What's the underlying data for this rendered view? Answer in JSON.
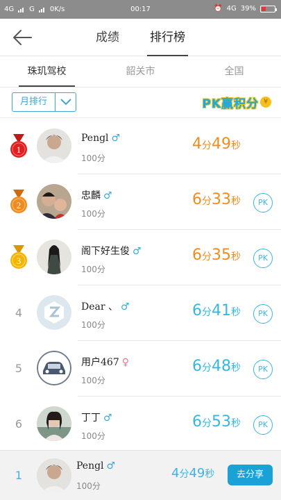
{
  "status_bar": {
    "network_left": "4G",
    "network_left2": "G",
    "speed": "0K/s",
    "time": "00:17",
    "network_right": "4G",
    "battery": "39%"
  },
  "header": {
    "tabs": [
      {
        "label": "成绩"
      },
      {
        "label": "排行榜"
      }
    ]
  },
  "subtabs": [
    {
      "label": "珠玑驾校"
    },
    {
      "label": "韶关市"
    },
    {
      "label": "全国"
    }
  ],
  "filter": {
    "period_label": "月排行",
    "banner_text": "PK赢积分",
    "banner_coin": "¥"
  },
  "rankings": [
    {
      "rank": "1",
      "name": "Pengl",
      "sex": "♂",
      "score": "100分",
      "min": "4",
      "sec": "49",
      "min_unit": "分",
      "sec_unit": "秒",
      "color": "#f08c1e",
      "medal": "#e02020"
    },
    {
      "rank": "2",
      "name": "忠麟",
      "sex": "♂",
      "score": "100分",
      "min": "6",
      "sec": "33",
      "min_unit": "分",
      "sec_unit": "秒",
      "pk": "PK",
      "color": "#f08c1e",
      "medal": "#f08c1e"
    },
    {
      "rank": "3",
      "name": "阁下好生俊",
      "sex": "♂",
      "score": "100分",
      "min": "6",
      "sec": "35",
      "min_unit": "分",
      "sec_unit": "秒",
      "pk": "PK",
      "color": "#f08c1e",
      "medal": "#f4b400"
    },
    {
      "rank": "4",
      "name": "Dear 、",
      "sex": "♂",
      "score": "100分",
      "min": "6",
      "sec": "41",
      "min_unit": "分",
      "sec_unit": "秒",
      "pk": "PK",
      "color": "#37b6e6"
    },
    {
      "rank": "5",
      "name": "用户467",
      "sex": "♀",
      "score": "100分",
      "min": "6",
      "sec": "48",
      "min_unit": "分",
      "sec_unit": "秒",
      "pk": "PK",
      "color": "#37b6e6"
    },
    {
      "rank": "6",
      "name": "丁丁",
      "sex": "♂",
      "score": "100分",
      "min": "6",
      "sec": "53",
      "min_unit": "分",
      "sec_unit": "秒",
      "pk": "PK",
      "color": "#37b6e6"
    }
  ],
  "my_rank": {
    "rank": "1",
    "name": "Pengl",
    "sex": "♂",
    "score": "100分",
    "min": "4",
    "sec": "49",
    "min_unit": "分",
    "sec_unit": "秒",
    "share_label": "去分享"
  }
}
